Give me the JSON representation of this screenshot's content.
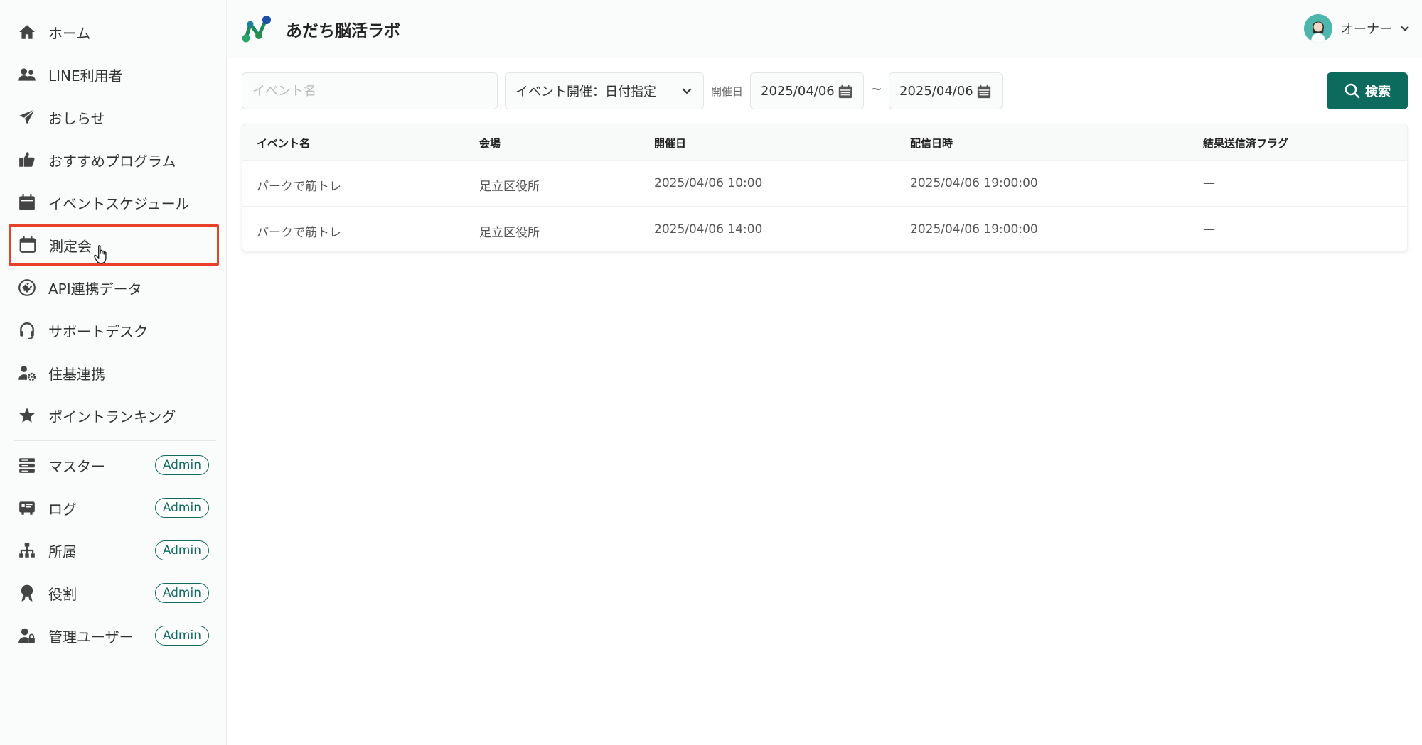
{
  "app": {
    "title": "あだち脳活ラボ",
    "user_name": "オーナー"
  },
  "sidebar": {
    "items": [
      {
        "label": "ホーム",
        "icon": "home-icon"
      },
      {
        "label": "LINE利用者",
        "icon": "users-icon"
      },
      {
        "label": "おしらせ",
        "icon": "paper-plane-icon"
      },
      {
        "label": "おすすめプログラム",
        "icon": "thumbs-up-icon"
      },
      {
        "label": "イベントスケジュール",
        "icon": "calendar-icon"
      },
      {
        "label": "測定会",
        "icon": "calendar-blank-icon"
      },
      {
        "label": "API連携データ",
        "icon": "plug-icon"
      },
      {
        "label": "サポートデスク",
        "icon": "headset-icon"
      },
      {
        "label": "住基連携",
        "icon": "user-gear-icon"
      },
      {
        "label": "ポイントランキング",
        "icon": "star-icon"
      }
    ],
    "admin_items": [
      {
        "label": "マスター",
        "badge": "Admin",
        "icon": "database-icon"
      },
      {
        "label": "ログ",
        "badge": "Admin",
        "icon": "log-icon"
      },
      {
        "label": "所属",
        "badge": "Admin",
        "icon": "sitemap-icon"
      },
      {
        "label": "役割",
        "badge": "Admin",
        "icon": "award-icon"
      },
      {
        "label": "管理ユーザー",
        "badge": "Admin",
        "icon": "user-lock-icon"
      }
    ]
  },
  "filters": {
    "event_name_placeholder": "イベント名",
    "event_type_selected": "イベント開催：日付指定",
    "date_label": "開催日",
    "date_from": "2025/04/06",
    "date_separator": "~",
    "date_to": "2025/04/06",
    "search_label": "検索"
  },
  "table": {
    "headers": [
      "イベント名",
      "会場",
      "開催日",
      "配信日時",
      "結果送信済フラグ"
    ],
    "rows": [
      [
        "パークで筋トレ",
        "足立区役所",
        "2025/04/06 10:00",
        "2025/04/06 19:00:00",
        "—"
      ],
      [
        "パークで筋トレ",
        "足立区役所",
        "2025/04/06 14:00",
        "2025/04/06 19:00:00",
        "—"
      ]
    ]
  },
  "colors": {
    "accent": "#0d6b5d",
    "highlight_border": "#e8402a"
  }
}
